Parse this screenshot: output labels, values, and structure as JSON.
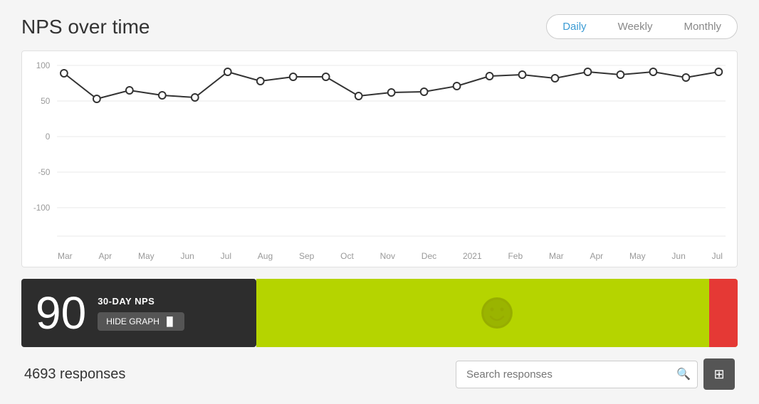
{
  "header": {
    "title": "NPS over time",
    "toggle": {
      "options": [
        "Daily",
        "Weekly",
        "Monthly"
      ],
      "active": "Daily"
    }
  },
  "chart": {
    "y_labels": [
      "100",
      "50",
      "0",
      "-50",
      "-100"
    ],
    "x_labels": [
      "Mar",
      "Apr",
      "May",
      "Jun",
      "Jul",
      "Aug",
      "Sep",
      "Oct",
      "Nov",
      "Dec",
      "2021",
      "Feb",
      "Mar",
      "Apr",
      "May",
      "Jun",
      "Jul"
    ],
    "data_points": [
      88,
      63,
      75,
      68,
      65,
      91,
      78,
      84,
      84,
      67,
      72,
      73,
      81,
      85,
      87,
      82,
      91,
      87,
      91,
      83,
      91
    ]
  },
  "nps_card": {
    "value": "90",
    "label": "30-DAY NPS",
    "hide_graph_btn": "HIDE GRAPH"
  },
  "responses": {
    "count": "4693 responses",
    "search_placeholder": "Search responses"
  }
}
